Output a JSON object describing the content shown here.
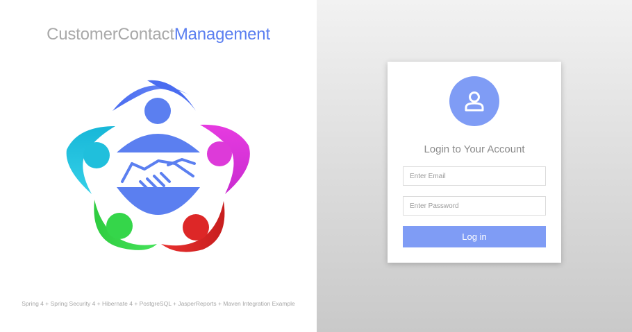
{
  "brand": {
    "title_part1": "CustomerContact",
    "title_part2": "Management"
  },
  "footer": {
    "text": "Spring 4 + Spring Security 4 + Hibernate 4 + PostgreSQL + JasperReports + Maven Integration Example"
  },
  "login": {
    "avatar_icon": "user-icon",
    "title": "Login to Your Account",
    "email_placeholder": "Enter Email",
    "password_placeholder": "Enter Password",
    "button_label": "Log in"
  },
  "colors": {
    "accent": "#7f9cf5",
    "brand_blue": "#5b7ff0",
    "muted_text": "#a9a9a9"
  },
  "logo": {
    "icon": "handshake-people-logo"
  }
}
